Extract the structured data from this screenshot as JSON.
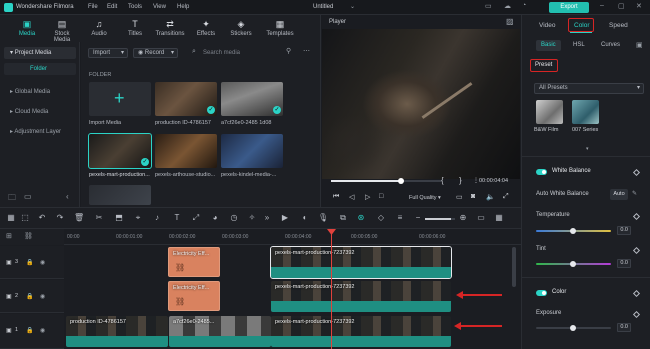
{
  "app": {
    "title": "Wondershare Filmora",
    "project": "Untitled",
    "export_label": "Export"
  },
  "menu": [
    "File",
    "Edit",
    "Tools",
    "View",
    "Help"
  ],
  "top_tabs": [
    {
      "label": "Media",
      "icon": "media-icon"
    },
    {
      "label": "Stock Media",
      "icon": "stock-media-icon"
    },
    {
      "label": "Audio",
      "icon": "music-icon"
    },
    {
      "label": "Titles",
      "icon": "titles-icon"
    },
    {
      "label": "Transitions",
      "icon": "transitions-icon"
    },
    {
      "label": "Effects",
      "icon": "effects-icon"
    },
    {
      "label": "Stickers",
      "icon": "stickers-icon"
    },
    {
      "label": "Templates",
      "icon": "templates-icon"
    }
  ],
  "sidebar": {
    "project_media": "Project Media",
    "folder": "Folder",
    "items": [
      "Global Media",
      "Cloud Media",
      "Adjustment Layer"
    ]
  },
  "media": {
    "import_label": "Import",
    "record_label": "Record",
    "search_placeholder": "Search media",
    "folder_header": "FOLDER",
    "items": [
      {
        "label": "Import Media"
      },
      {
        "label": "production ID-4786157"
      },
      {
        "label": "a7cf26e0-2485 1d08"
      },
      {
        "label": "pexels-mart-production..."
      },
      {
        "label": "pexels-arthouse-studio..."
      },
      {
        "label": "pexels-kindel-media-..."
      }
    ]
  },
  "player": {
    "label": "Player",
    "time_current": "00:00:04:04",
    "quality": "Full Quality",
    "bracket_in": "{",
    "bracket_out": "}"
  },
  "right_panel": {
    "tabs": [
      "Video",
      "Color",
      "Speed"
    ],
    "subtabs": [
      "Basic",
      "HSL",
      "Curves"
    ],
    "preset_label": "Preset",
    "presets_dropdown": "All Presets",
    "presets": [
      {
        "label": "B&W Film"
      },
      {
        "label": "007 Series"
      }
    ],
    "white_balance": "White Balance",
    "auto_white_balance": "Auto White Balance",
    "auto_label": "Auto",
    "temperature": {
      "label": "Temperature",
      "value": "0.0"
    },
    "tint": {
      "label": "Tint",
      "value": "0.0"
    },
    "color_section": "Color",
    "exposure": {
      "label": "Exposure",
      "value": "0.0"
    }
  },
  "timeline": {
    "timecodes": [
      "00:00",
      "00:00:01:00",
      "00:00:02:00",
      "00:00:03:00",
      "00:00:04:00",
      "00:00:05:00",
      "00:00:06:00"
    ],
    "tracks": [
      {
        "number": "3",
        "clips": [
          {
            "label": "Electricity Eff..."
          },
          {
            "label": "pexels-mart-production-7237392"
          }
        ]
      },
      {
        "number": "2",
        "clips": [
          {
            "label": "Electricity Eff..."
          },
          {
            "label": "pexels-mart-production-7237392"
          }
        ]
      },
      {
        "number": "1",
        "clips": [
          {
            "label": "production ID-4786157"
          },
          {
            "label": "a7cf26e0-2485..."
          },
          {
            "label": "pexels-mart-production-7237392"
          }
        ]
      }
    ]
  }
}
